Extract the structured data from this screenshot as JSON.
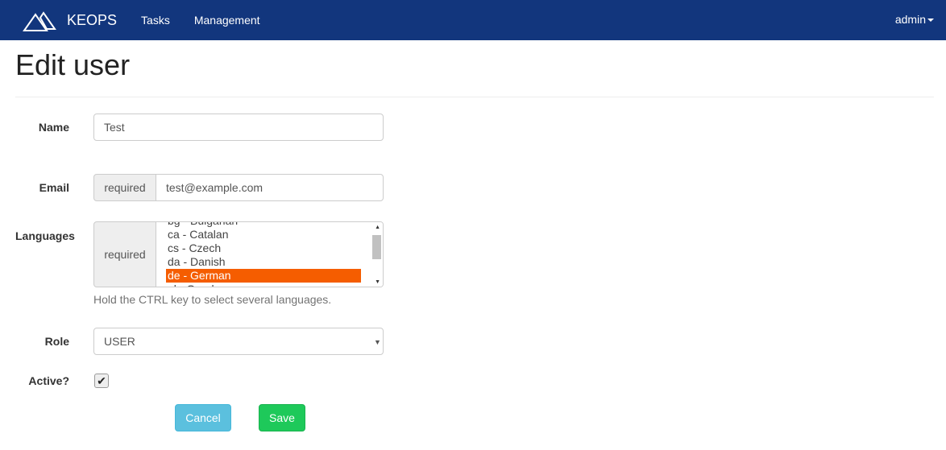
{
  "nav": {
    "brand": "KEOPS",
    "links": [
      "Tasks",
      "Management"
    ],
    "user": "admin"
  },
  "page": {
    "title": "Edit user"
  },
  "form": {
    "name_label": "Name",
    "name_value": "Test",
    "email_label": "Email",
    "email_addon": "required",
    "email_value": "test@example.com",
    "languages_label": "Languages",
    "languages_addon": "required",
    "languages": [
      {
        "label": "bg - Bulgarian",
        "selected": false
      },
      {
        "label": "ca - Catalan",
        "selected": false
      },
      {
        "label": "cs - Czech",
        "selected": false
      },
      {
        "label": "da - Danish",
        "selected": false
      },
      {
        "label": "de - German",
        "selected": true
      },
      {
        "label": "el - Greek",
        "selected": false
      }
    ],
    "languages_help": "Hold the CTRL key to select several languages.",
    "role_label": "Role",
    "role_value": "USER",
    "active_label": "Active?",
    "active_checked": true,
    "cancel_label": "Cancel",
    "save_label": "Save"
  },
  "colors": {
    "navbar": "#12367d",
    "selected": "#f55d00",
    "cancel": "#5bc0de",
    "save": "#1ec95a"
  }
}
